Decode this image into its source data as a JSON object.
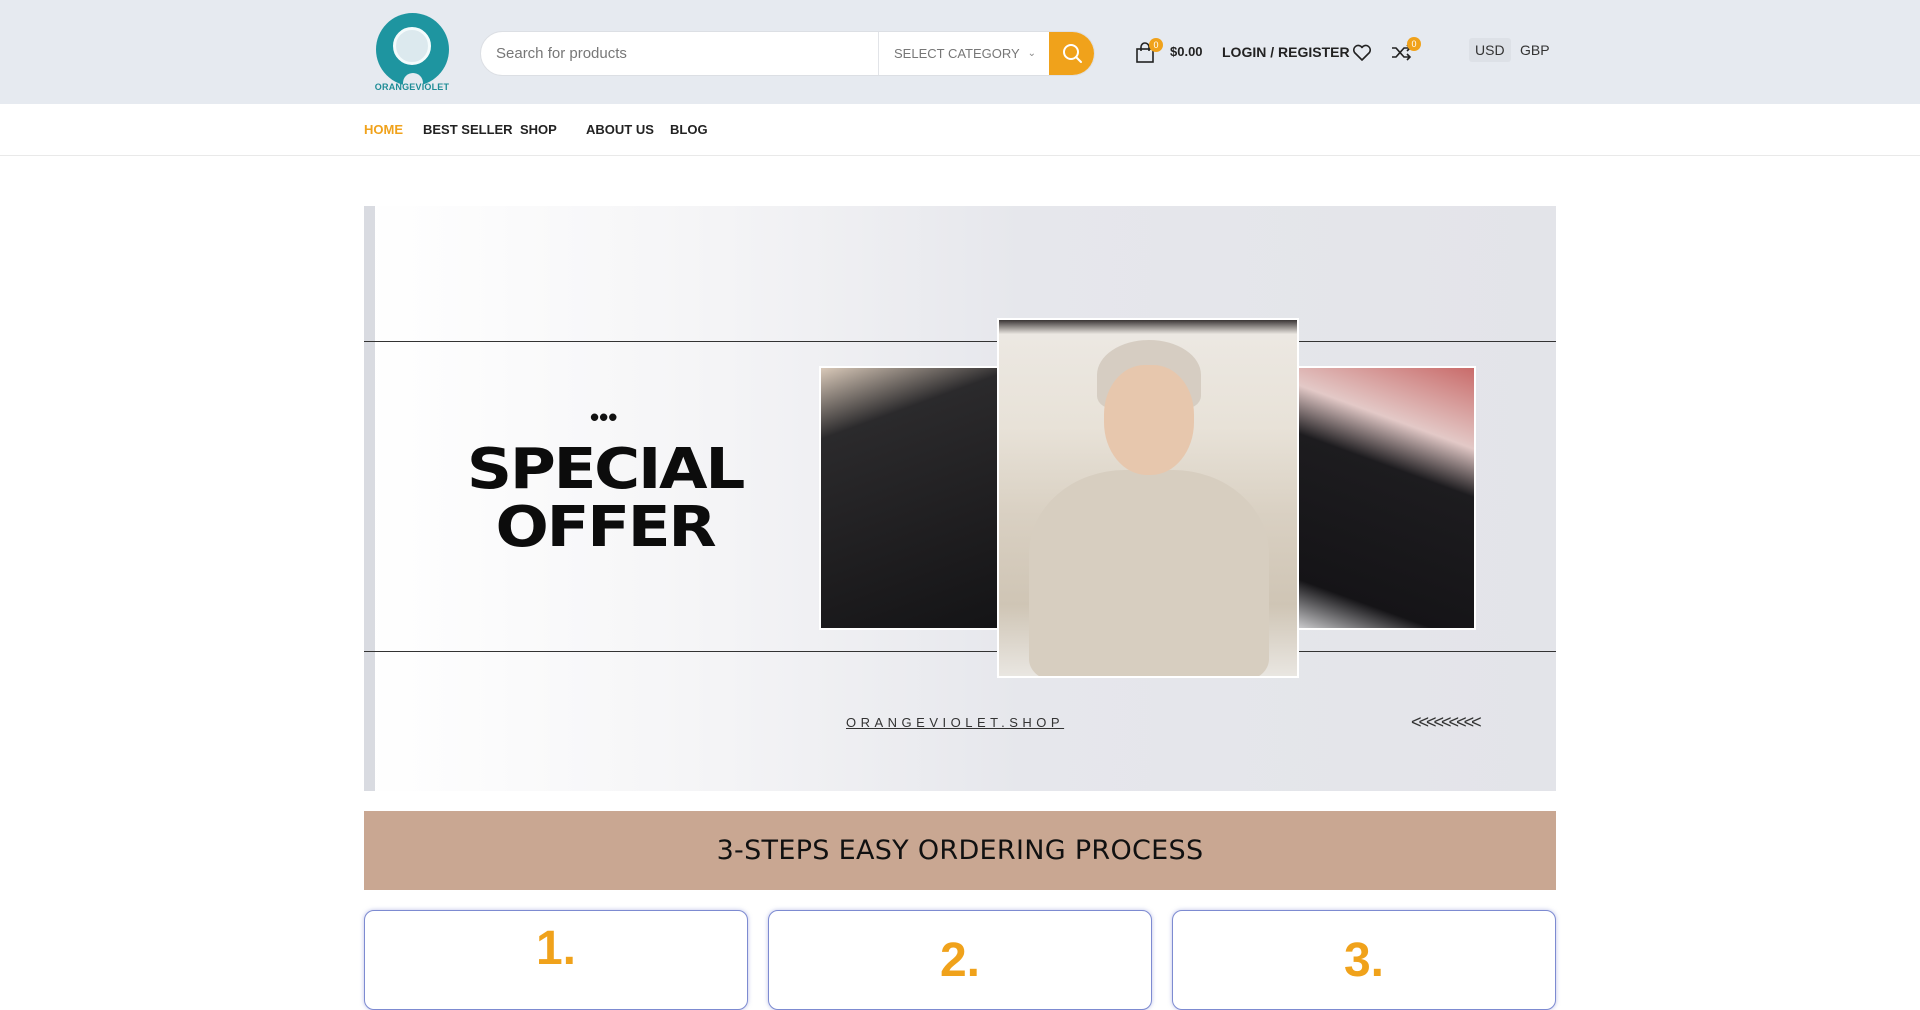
{
  "brand": {
    "name": "ORANGEVIOLET"
  },
  "search": {
    "placeholder": "Search for products",
    "category": "SELECT CATEGORY"
  },
  "header": {
    "cart_count": "0",
    "cart_total": "$0.00",
    "login_label": "LOGIN / REGISTER",
    "compare_count": "0",
    "currencies": [
      "USD",
      "GBP"
    ],
    "accent_color": "#f0a21b"
  },
  "nav": {
    "items": [
      "HOME",
      "BEST SELLER",
      "SHOP",
      "ABOUT US",
      "BLOG"
    ],
    "active": "HOME"
  },
  "hero": {
    "dots": "•••",
    "headline_line1": "SPECIAL",
    "headline_line2": "OFFER",
    "site": "ORANGEVIOLET.SHOP",
    "arrows": "<<<<<<<<<"
  },
  "steps": {
    "title": "3-STEPS EASY ORDERING PROCESS",
    "numbers": [
      "1.",
      "2.",
      "3."
    ],
    "bar_color": "#c9a792"
  }
}
